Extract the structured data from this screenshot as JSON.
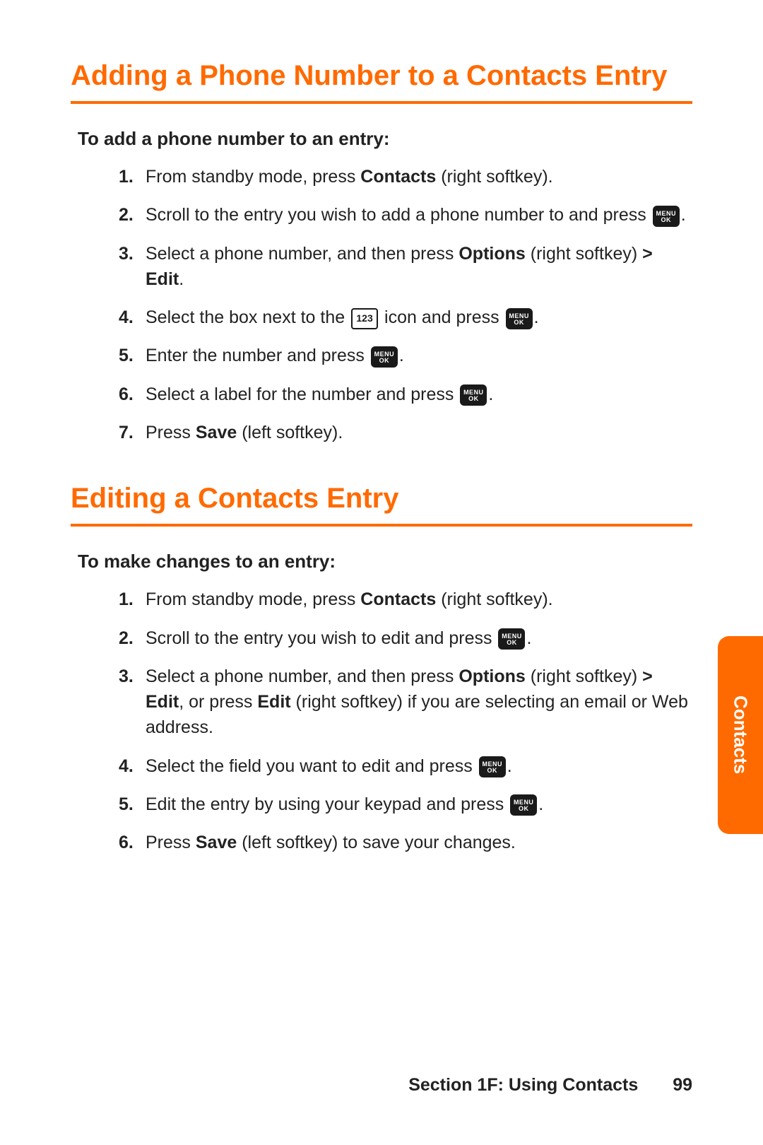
{
  "colors": {
    "accent": "#ff6a00"
  },
  "icons": {
    "menu_ok_top": "MENU",
    "menu_ok_bottom": "OK",
    "num_icon_label": "123"
  },
  "section1": {
    "title": "Adding a Phone Number to a Contacts Entry",
    "sub": "To add a phone number to an entry:",
    "steps": {
      "s1_a": "From standby mode, press ",
      "s1_b": "Contacts",
      "s1_c": " (right softkey).",
      "s2_a": "Scroll to the entry you wish to add a phone number to and press ",
      "s3_a": "Select a phone number, and then press ",
      "s3_b": "Options",
      "s3_c": " (right softkey) ",
      "s3_d": "> Edit",
      "s3_e": ".",
      "s4_a": "Select the box next to the ",
      "s4_b": " icon and press ",
      "s5_a": "Enter the number and press ",
      "s6_a": "Select a label for the number and press ",
      "s7_a": "Press ",
      "s7_b": "Save",
      "s7_c": " (left softkey)."
    }
  },
  "section2": {
    "title": "Editing a Contacts Entry",
    "sub": "To make changes to an entry:",
    "steps": {
      "s1_a": "From standby mode, press ",
      "s1_b": "Contacts",
      "s1_c": " (right softkey).",
      "s2_a": "Scroll to the entry you wish to edit and press ",
      "s3_a": "Select a phone number, and then press ",
      "s3_b": "Options",
      "s3_c": " (right softkey) ",
      "s3_d": "> Edit",
      "s3_e": ", or press ",
      "s3_f": "Edit",
      "s3_g": " (right softkey) if you are selecting an email or Web address.",
      "s4_a": "Select the field you want to edit and press ",
      "s5_a": "Edit the entry by using your keypad and press ",
      "s6_a": "Press ",
      "s6_b": "Save",
      "s6_c": " (left softkey) to save your changes."
    }
  },
  "nums": {
    "n1": "1.",
    "n2": "2.",
    "n3": "3.",
    "n4": "4.",
    "n5": "5.",
    "n6": "6.",
    "n7": "7."
  },
  "side_tab": "Contacts",
  "footer": {
    "section": "Section 1F: Using Contacts",
    "page": "99"
  },
  "period": "."
}
